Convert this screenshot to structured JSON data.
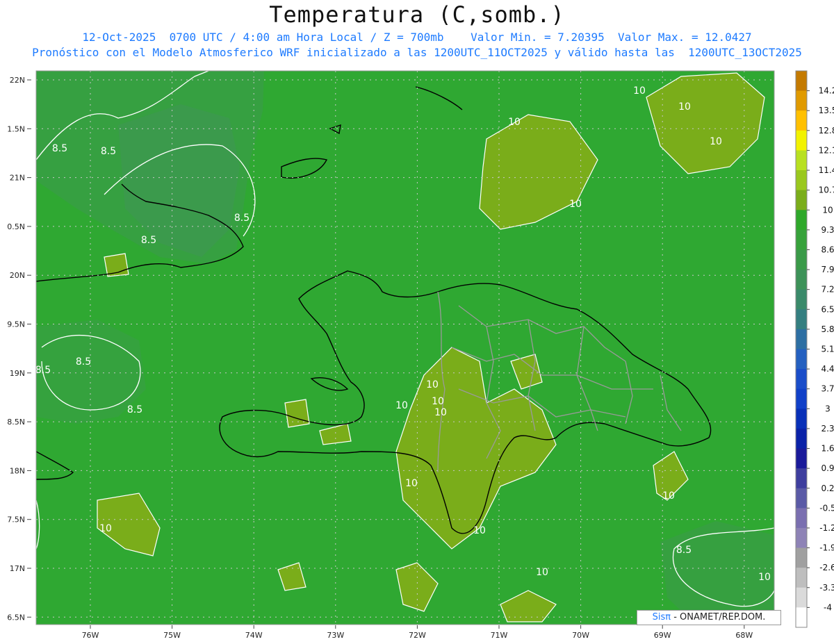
{
  "header": {
    "title": "Temperatura (C,somb.)",
    "line1": "12-Oct-2025  0700 UTC / 4:00 am Hora Local / Z = 700mb    Valor Min. = 7.20395  Valor Max. = 12.0427",
    "line2": "Pronóstico con el Modelo Atmosferico WRF inicializado a las 1200UTC_11OCT2025 y válido hasta las  1200UTC_13OCT2025"
  },
  "axes": {
    "lat_labels": [
      "22N",
      "1.5N",
      "21N",
      "0.5N",
      "20N",
      "9.5N",
      "19N",
      "8.5N",
      "18N",
      "7.5N",
      "17N",
      "6.5N"
    ],
    "lon_labels": [
      "76W",
      "75W",
      "74W",
      "73W",
      "72W",
      "71W",
      "70W",
      "69W",
      "68W"
    ]
  },
  "colorbar": {
    "labels": [
      "14.2",
      "13.5",
      "12.8",
      "12.1",
      "11.4",
      "10.7",
      "10",
      "9.3",
      "8.6",
      "7.9",
      "7.2",
      "6.5",
      "5.8",
      "5.1",
      "4.4",
      "3.7",
      "3",
      "2.3",
      "1.6",
      "0.9",
      "0.2",
      "-0.5",
      "-1.2",
      "-1.9",
      "-2.6",
      "-3.3",
      "-4"
    ],
    "colors": [
      "#c47a00",
      "#e09a00",
      "#ffc000",
      "#f2f200",
      "#b8e020",
      "#9ac81e",
      "#7aad1a",
      "#2ea82a",
      "#37a23b",
      "#3a9a48",
      "#3d9258",
      "#3a8a6a",
      "#347f80",
      "#2d6fa3",
      "#2460c0",
      "#1a4dc9",
      "#1040c8",
      "#0830b8",
      "#0a22a8",
      "#1a1a9a",
      "#3e3e9e",
      "#5a5aa6",
      "#7a6fb0",
      "#8e83b6",
      "#a0a0a0",
      "#bebebe",
      "#dadada",
      "#ffffff"
    ]
  },
  "contour_labels": [
    "8.5",
    "8.5",
    "8.5",
    "8.5",
    "8.5",
    "8.5",
    "8.5",
    "8.5",
    "10",
    "10",
    "10",
    "10",
    "10",
    "10",
    "10",
    "10",
    "10",
    "10",
    "10",
    "10",
    "10",
    "10",
    "10"
  ],
  "credit": {
    "brand": "Sisπ",
    "text": " - ONAMET/REP.DOM."
  }
}
